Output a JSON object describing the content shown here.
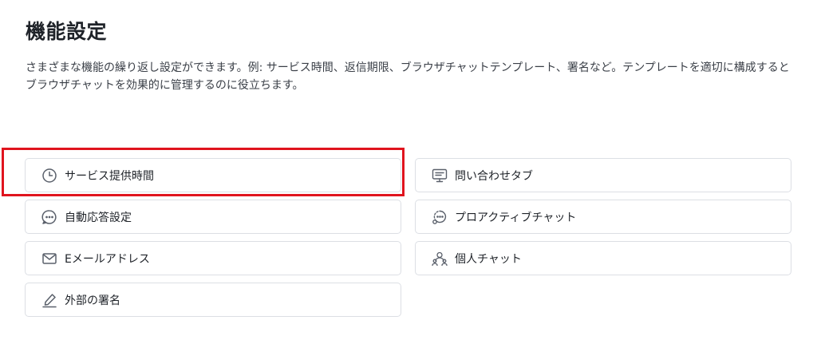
{
  "header": {
    "title": "機能設定",
    "description": "さまざまな機能の繰り返し設定ができます。例: サービス時間、返信期限、ブラウザチャットテンプレート、署名など。テンプレートを適切に構成するとブラウザチャットを効果的に管理するのに役立ちます。"
  },
  "features": {
    "left": [
      {
        "label": "サービス提供時間",
        "icon": "clock-icon"
      },
      {
        "label": "自動応答設定",
        "icon": "chat-bubble-dots-icon"
      },
      {
        "label": "Eメールアドレス",
        "icon": "mail-icon"
      },
      {
        "label": "外部の署名",
        "icon": "signature-pen-icon"
      }
    ],
    "right": [
      {
        "label": "問い合わせタブ",
        "icon": "monitor-chat-icon"
      },
      {
        "label": "プロアクティブチャット",
        "icon": "proactive-chat-icon"
      },
      {
        "label": "個人チャット",
        "icon": "person-group-icon"
      }
    ]
  },
  "colors": {
    "highlight": "#e0141e",
    "border": "#dcdfe4",
    "icon": "#5a606b"
  }
}
